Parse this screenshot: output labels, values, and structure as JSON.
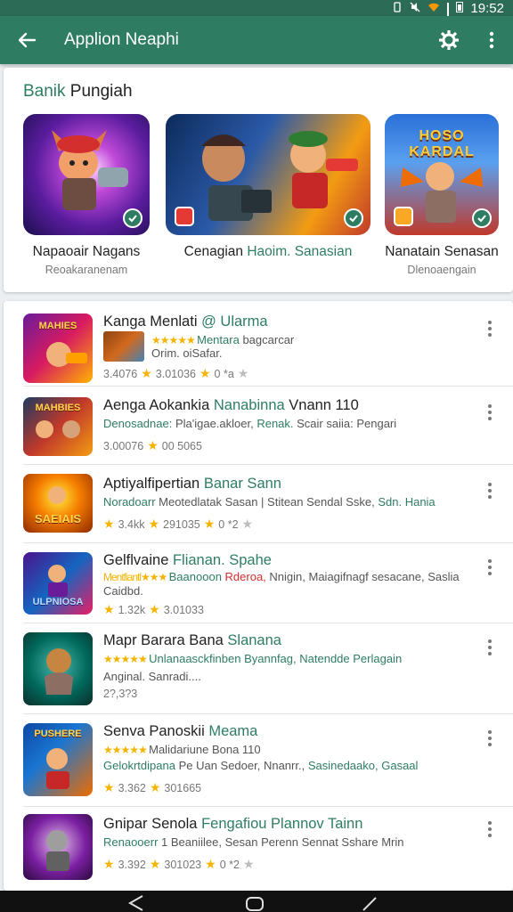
{
  "status_bar": {
    "time": "19:52",
    "icons": [
      "vibrate-icon",
      "mute-icon",
      "wifi-icon",
      "signal-icon",
      "battery-icon"
    ]
  },
  "app_bar": {
    "title": "Applion Neaphi",
    "back_icon": "arrow-left-icon",
    "filter_icon": "settings-cog-icon",
    "more_icon": "more-vert-icon"
  },
  "colors": {
    "primary": "#2e7d63",
    "status_bar": "#2c6b56",
    "accent_link": "#2e7d63",
    "star": "#f4b400"
  },
  "featured": {
    "title_a": "Banik",
    "title_b": " Pungiah",
    "cards": [
      {
        "name": "Napaoair Nagans",
        "sub": "Reoakaranenam",
        "thumb_text": ""
      },
      {
        "name_a": "Cenagian ",
        "name_b": "Haoim. Sanasian",
        "sub": ""
      },
      {
        "name": "Nanatain Senasan",
        "sub": "Dlenoaengain",
        "thumb_text": "HOSO KARDAL"
      }
    ]
  },
  "apps": [
    {
      "title_a": "Kanga Menlati",
      "title_b": " @ Ularma",
      "line1_a": "★★★★★ ",
      "line1_b": "Mentara",
      "line1_c": " bagcarcar",
      "line2": "Orim. oiSafar.",
      "meta_a": "3.4076",
      "meta_b": "3.01036",
      "meta_c": "0 *a",
      "icon_text": "MAHIES"
    },
    {
      "title_a": "Aenga Aokankia",
      "title_b": " Nanabinna",
      "title_c": " Vnann 110",
      "line1_a": "Denosadnae: ",
      "line1_b": "Pla'igae.akloer, ",
      "line1_c": "Renak. ",
      "line1_d": "Scair saiia: Pengari",
      "meta_a": "3.00076",
      "meta_b": "00 5065",
      "icon_text": "MAHBIES"
    },
    {
      "title_a": "Aptiyalfipertian",
      "title_b": " Banar Sann",
      "line1_a": "Noradoarr ",
      "line1_b": "Meotedlatak Sasan | Stitean Sendal Sske, ",
      "line1_c": "Sdn. Hania",
      "meta_a": "3.4kk",
      "meta_b": "291035",
      "meta_c": "0 *2",
      "icon_text": "SAEIAIS"
    },
    {
      "title_a": "Gelflvaine",
      "title_b": " Flianan. Spahe",
      "line1_a": "Mentfiantl★★★ ",
      "line1_b": "Baanooon ",
      "line1_c": "Rderoa, ",
      "line1_d": "Nnigin, Maiagifnagf sesacane, Saslia",
      "line2": "Caidbd.",
      "meta_a": "1.32k",
      "meta_b": "3.01033",
      "icon_text": "ULPNIOSA"
    },
    {
      "title_a": "Mapr Barara Bana",
      "title_b": " Slanana",
      "line1_a": "★★★★★ ",
      "line1_b": "Unlanaasckfinben Byannfag, ",
      "line1_c": "Natendde Perlagain",
      "line2": "Anginal. Sanradi....",
      "meta_a": "2?,3?3",
      "icon_text": ""
    },
    {
      "title_a": "Senva Panoskii",
      "title_b": " Meama",
      "line1_a": "★★★★★ ",
      "line1_b": "Malidariune Bona 110",
      "line2_a": "Gelokrtdipana ",
      "line2_b": "Pe Uan Sedoer, Nnanrr., ",
      "line2_c": "Sasinedaako, Gasaal",
      "meta_a": "3.362",
      "meta_b": "301665",
      "icon_text": "PUSHERE"
    },
    {
      "title_a": "Gnipar Senola",
      "title_b": " Fengafiou Plannov Tainn",
      "line1_a": "Renaooerr ",
      "line1_b": "1 Beaniilee, Sesan Perenn Sennat Sshare Mrin",
      "meta_a": "3.392",
      "meta_b": "301023",
      "meta_c": "0 *2",
      "icon_text": ""
    }
  ],
  "nav_bar": {
    "back_icon": "nav-back-icon",
    "home_icon": "nav-home-icon",
    "recents_icon": "nav-recents-icon"
  }
}
